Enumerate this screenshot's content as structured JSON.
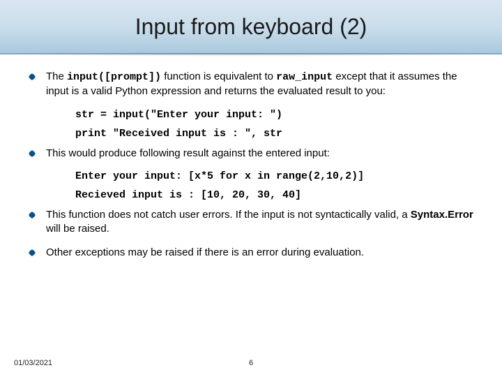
{
  "header": {
    "title": "Input from keyboard (2)"
  },
  "bullets": {
    "b1": {
      "pre": "The ",
      "code1": "input([prompt])",
      "mid": " function is equivalent to ",
      "code2": "raw_input",
      "post": " except that it assumes the input is a valid Python expression and returns the evaluated result to you:"
    },
    "code1": "str = input(\"Enter your input: \")",
    "code2": "print \"Received input is : \", str",
    "b2": "This would produce following result against the entered input:",
    "code3": "Enter your input: [x*5 for x in range(2,10,2)]",
    "code4": "Recieved input is : [10, 20, 30, 40]",
    "b3": {
      "pre": "This function does not catch user errors. If the input is not syntactically valid, a ",
      "bold": "Syntax.Error",
      "post": " will be raised."
    },
    "b4": "Other exceptions may be raised if there is an error during evaluation."
  },
  "footer": {
    "date": "01/03/2021",
    "page": "6"
  }
}
